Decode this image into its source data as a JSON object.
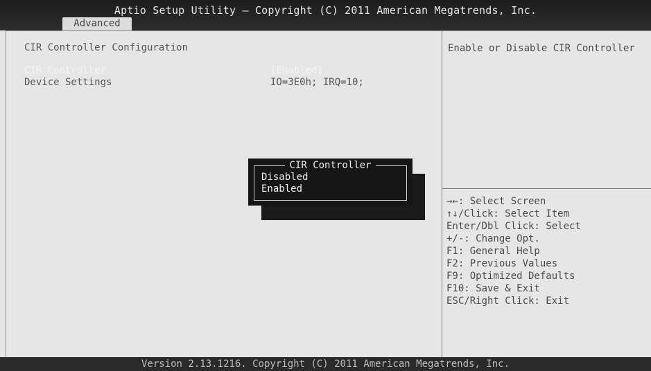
{
  "header": {
    "title": "Aptio Setup Utility – Copyright (C) 2011 American Megatrends, Inc.",
    "active_tab": "Advanced"
  },
  "main": {
    "section_title": "CIR Controller Configuration",
    "settings": [
      {
        "label": "CIR Controller",
        "value": "[Enabled]"
      },
      {
        "label": "Device Settings",
        "value": "IO=3E0h; IRQ=10;"
      }
    ]
  },
  "help": {
    "text": "Enable or Disable CIR Controller"
  },
  "keys": [
    "→←: Select Screen",
    "↑↓/Click: Select Item",
    "Enter/Dbl Click: Select",
    "+/-: Change Opt.",
    "F1: General Help",
    "F2: Previous Values",
    "F9: Optimized Defaults",
    "F10: Save & Exit",
    "ESC/Right Click: Exit"
  ],
  "popup": {
    "title": "CIR Controller",
    "options": [
      "Disabled",
      "Enabled"
    ]
  },
  "footer": {
    "text": "Version 2.13.1216. Copyright (C) 2011 American Megatrends, Inc."
  },
  "colors": {
    "background": "#e6e6e6",
    "header": "#1c1c1c",
    "popup": "#161616",
    "selected_text": "#f4f4f4"
  }
}
